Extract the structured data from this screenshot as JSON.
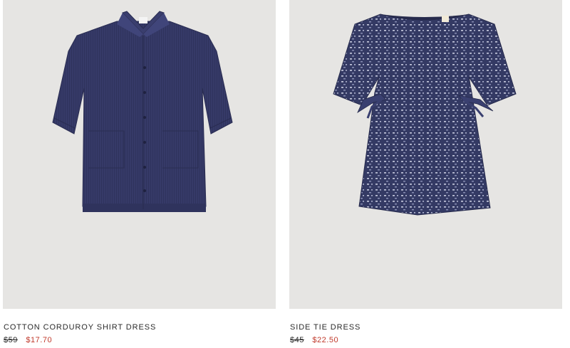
{
  "products": [
    {
      "name": "COTTON CORDUROY SHIRT DRESS",
      "original_price": "$59",
      "sale_price": "$17.70",
      "image_icon": "shirt-dress-image"
    },
    {
      "name": "SIDE TIE DRESS",
      "original_price": "$45",
      "sale_price": "$22.50",
      "image_icon": "printed-dress-image"
    }
  ],
  "colors": {
    "photo_background": "#e6e5e3",
    "garment_navy": "#353a66",
    "sale_red": "#c0392b",
    "text": "#2b2b2b"
  }
}
